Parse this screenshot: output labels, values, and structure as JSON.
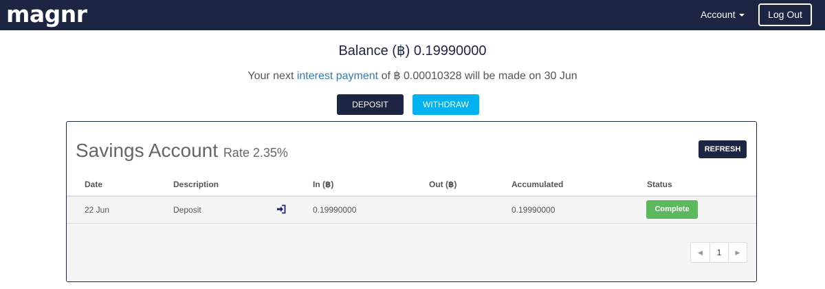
{
  "navbar": {
    "logo": "magnr",
    "account_label": "Account",
    "logout_label": "Log Out"
  },
  "balance": {
    "text": "Balance (฿) 0.19990000"
  },
  "interest": {
    "prefix": "Your next ",
    "link_text": "interest payment",
    "suffix": " of ฿ 0.00010328 will be made on 30 Jun"
  },
  "actions": {
    "deposit_label": "DEPOSIT",
    "withdraw_label": "WITHDRAW"
  },
  "panel": {
    "title": "Savings Account",
    "rate": "Rate 2.35%",
    "refresh_label": "REFRESH",
    "columns": [
      "Date",
      "Description",
      "In (฿)",
      "Out (฿)",
      "Accumulated",
      "Status"
    ],
    "rows": [
      {
        "date": "22 Jun",
        "description": "Deposit",
        "icon": "sign-in-icon",
        "in": "0.19990000",
        "out": "",
        "accumulated": "0.19990000",
        "status": "Complete"
      }
    ],
    "pagination": {
      "prev": "◀",
      "current_page": "1",
      "next": "▶"
    }
  },
  "colors": {
    "navbar": "#1c2541",
    "deposit_button": "#1c2541",
    "withdraw_button": "#00b3f0",
    "status_complete": "#5cb85c",
    "link": "#337ab7"
  }
}
